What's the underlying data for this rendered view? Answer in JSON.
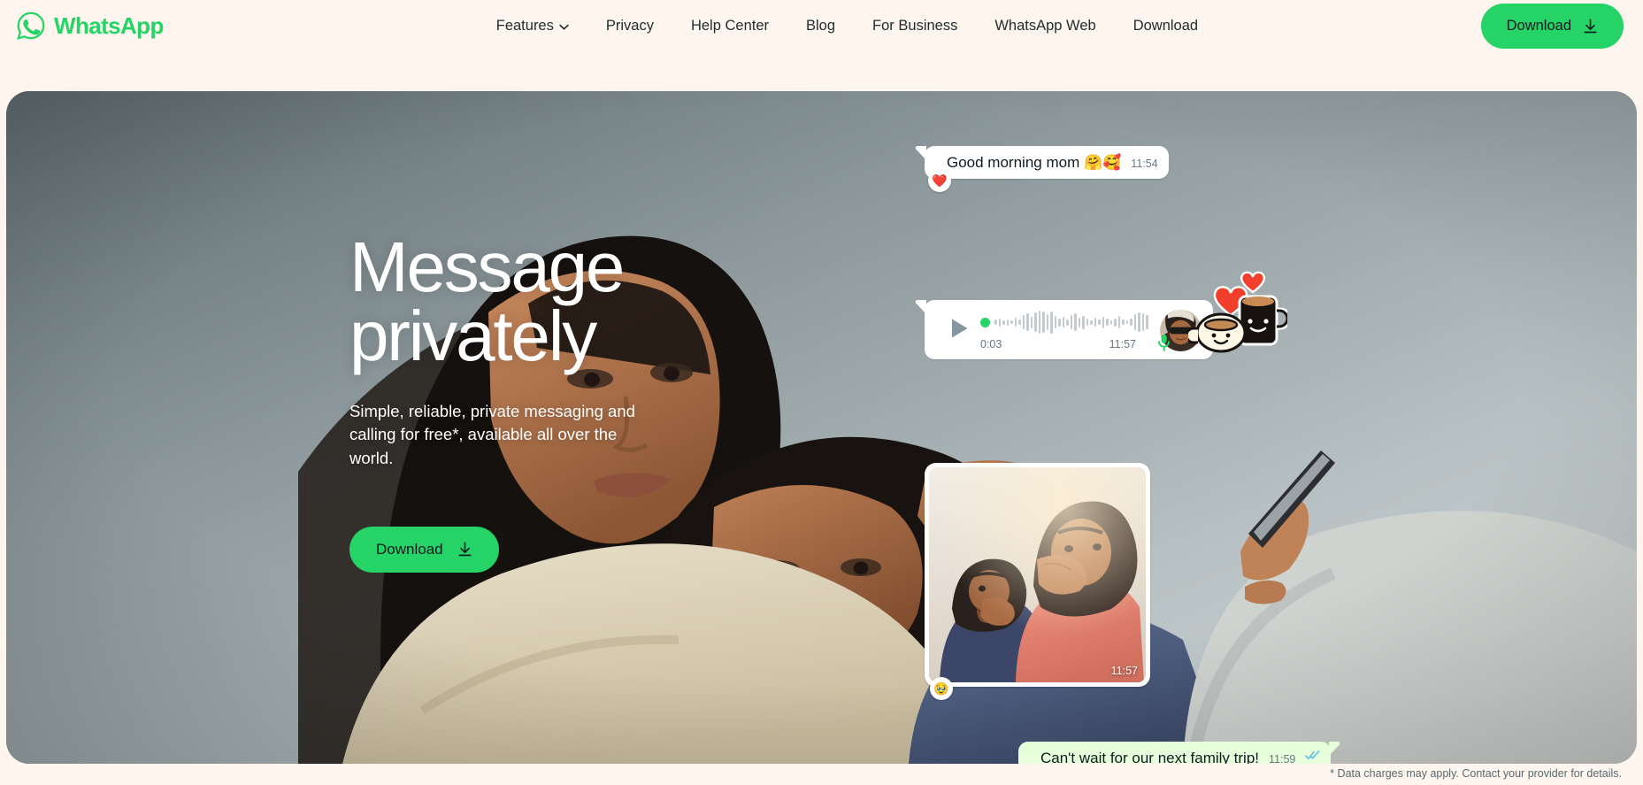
{
  "brand": {
    "name": "WhatsApp",
    "logo_icon": "whatsapp-logo-icon",
    "color": "#25D366"
  },
  "nav": {
    "items": [
      {
        "label": "Features",
        "has_chevron": true,
        "icon": "chevron-down-icon"
      },
      {
        "label": "Privacy",
        "has_chevron": false
      },
      {
        "label": "Help Center",
        "has_chevron": false
      },
      {
        "label": "Blog",
        "has_chevron": false
      },
      {
        "label": "For Business",
        "has_chevron": false
      },
      {
        "label": "WhatsApp Web",
        "has_chevron": false
      },
      {
        "label": "Download",
        "has_chevron": false
      }
    ],
    "cta": {
      "label": "Download",
      "icon": "download-arrow-icon"
    }
  },
  "hero": {
    "title_line1": "Message",
    "title_line2": "privately",
    "subtitle": "Simple, reliable, private messaging and calling for free*, available all over the world.",
    "cta": {
      "label": "Download",
      "icon": "download-arrow-icon"
    },
    "background_color": "#6E7C80"
  },
  "chat": {
    "messages": [
      {
        "id": "msg-good-morning",
        "direction": "incoming",
        "text": "Good morning mom 🤗🥰",
        "time": "11:54",
        "reaction": "❤️"
      },
      {
        "id": "msg-voice",
        "direction": "incoming",
        "type": "voice",
        "duration": "0:03",
        "time": "11:57",
        "mic_icon": "microphone-icon",
        "play_icon": "play-icon"
      },
      {
        "id": "msg-photo",
        "direction": "incoming",
        "type": "photo",
        "time": "11:57",
        "reaction": "🥹"
      },
      {
        "id": "msg-family-trip",
        "direction": "outgoing",
        "text": "Can't wait for our next family trip!",
        "time": "11:59",
        "status_icon": "double-check-read-icon",
        "status_color": "#53BDEB"
      }
    ],
    "sticker": {
      "name": "coffee-cups-hearts-sticker"
    }
  },
  "footnote": "* Data charges may apply. Contact your provider for details."
}
